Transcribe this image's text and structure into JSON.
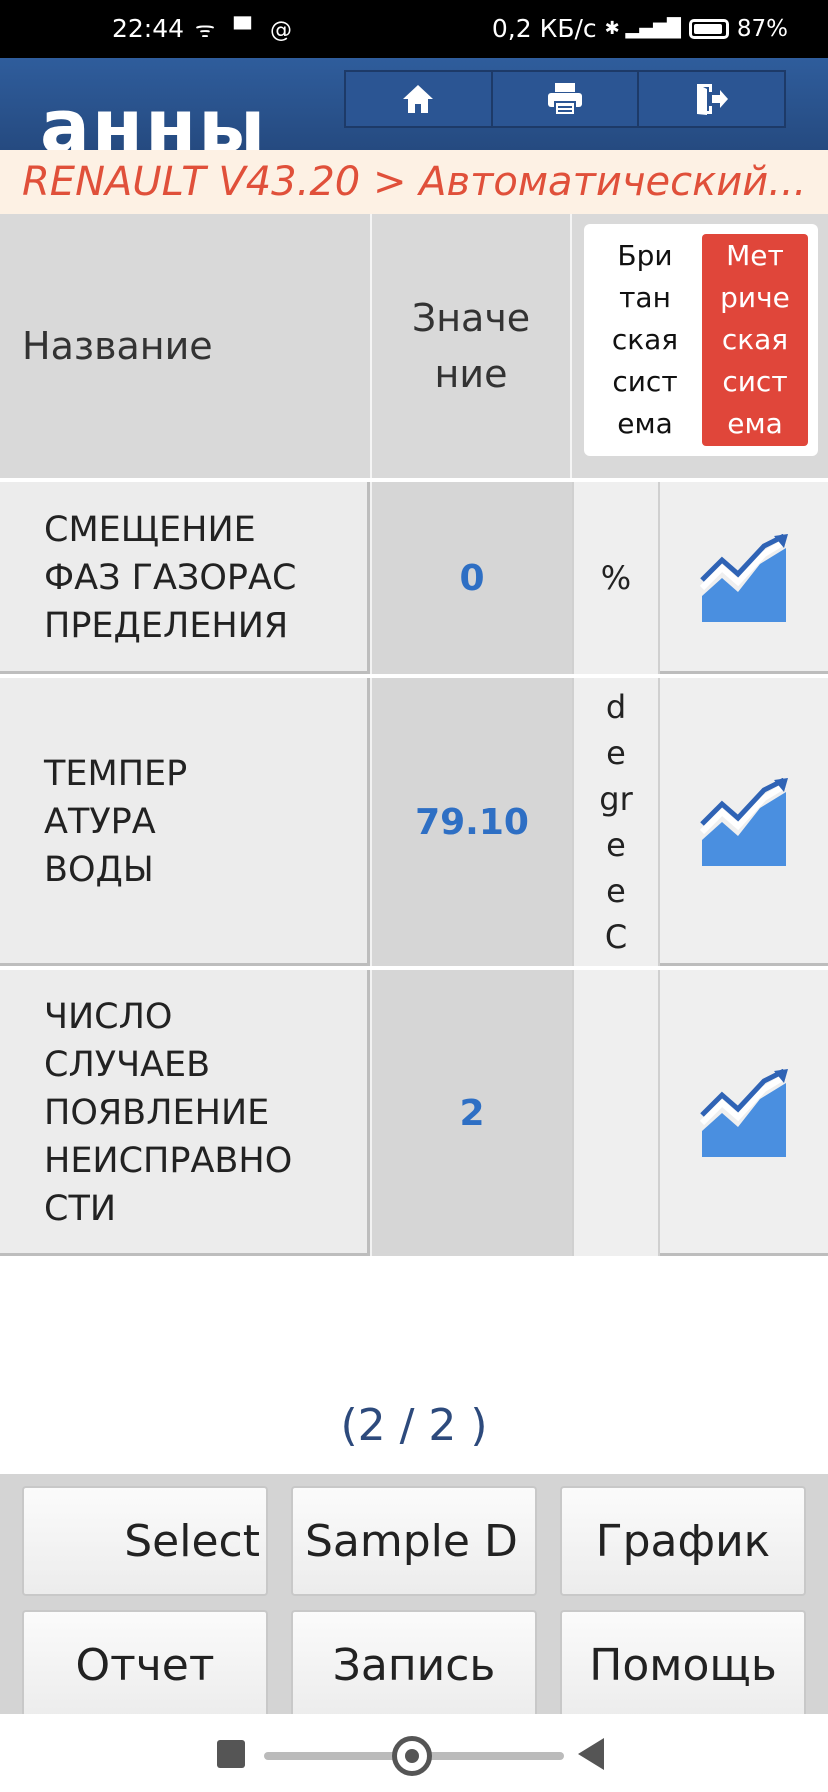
{
  "status_bar": {
    "time": "22:44",
    "left_icons": "ᯤ ▀ @",
    "speed": "0,2 КБ/с",
    "signal": "✱ ▂▄▆█",
    "battery": "87"
  },
  "header": {
    "big_text": "анны",
    "buttons": [
      {
        "icon": "home-icon"
      },
      {
        "icon": "print-icon"
      },
      {
        "icon": "exit-icon"
      }
    ]
  },
  "breadcrumb": "RENAULT V43.20 > Автоматический...",
  "table": {
    "header": {
      "name": "Название",
      "value": "Значе\nние",
      "unit_british": "Бри\nтан\nская\nсист\nема",
      "unit_metric": "Мет\nриче\nская\nсист\nема"
    },
    "rows": [
      {
        "name": "СМЕЩЕНИЕ\nФАЗ ГАЗОРАС\nПРЕДЕЛЕНИЯ",
        "value": "0",
        "unit": "%"
      },
      {
        "name": "ТЕМПЕР\nАТУРА\nВОДЫ",
        "value": "79.10",
        "unit": "d\ne\ngr\nee\nC"
      },
      {
        "name": "ЧИСЛО\nСЛУЧАЕВ\nПОЯВЛЕНИЕ\nНЕИСПРАВНО\nСТИ",
        "value": "2",
        "unit": ""
      }
    ]
  },
  "page_indicator": "(2 / 2 )",
  "buttons": {
    "select": "Select",
    "sample": "Sample D",
    "graph": "График",
    "report": "Отчет",
    "record": "Запись",
    "help": "Помощь"
  },
  "colors": {
    "header_blue": "#2f5d9c",
    "breadcrumb_text": "#e0503a",
    "value_blue": "#2e6fc4",
    "metric_active": "#e0463a"
  }
}
